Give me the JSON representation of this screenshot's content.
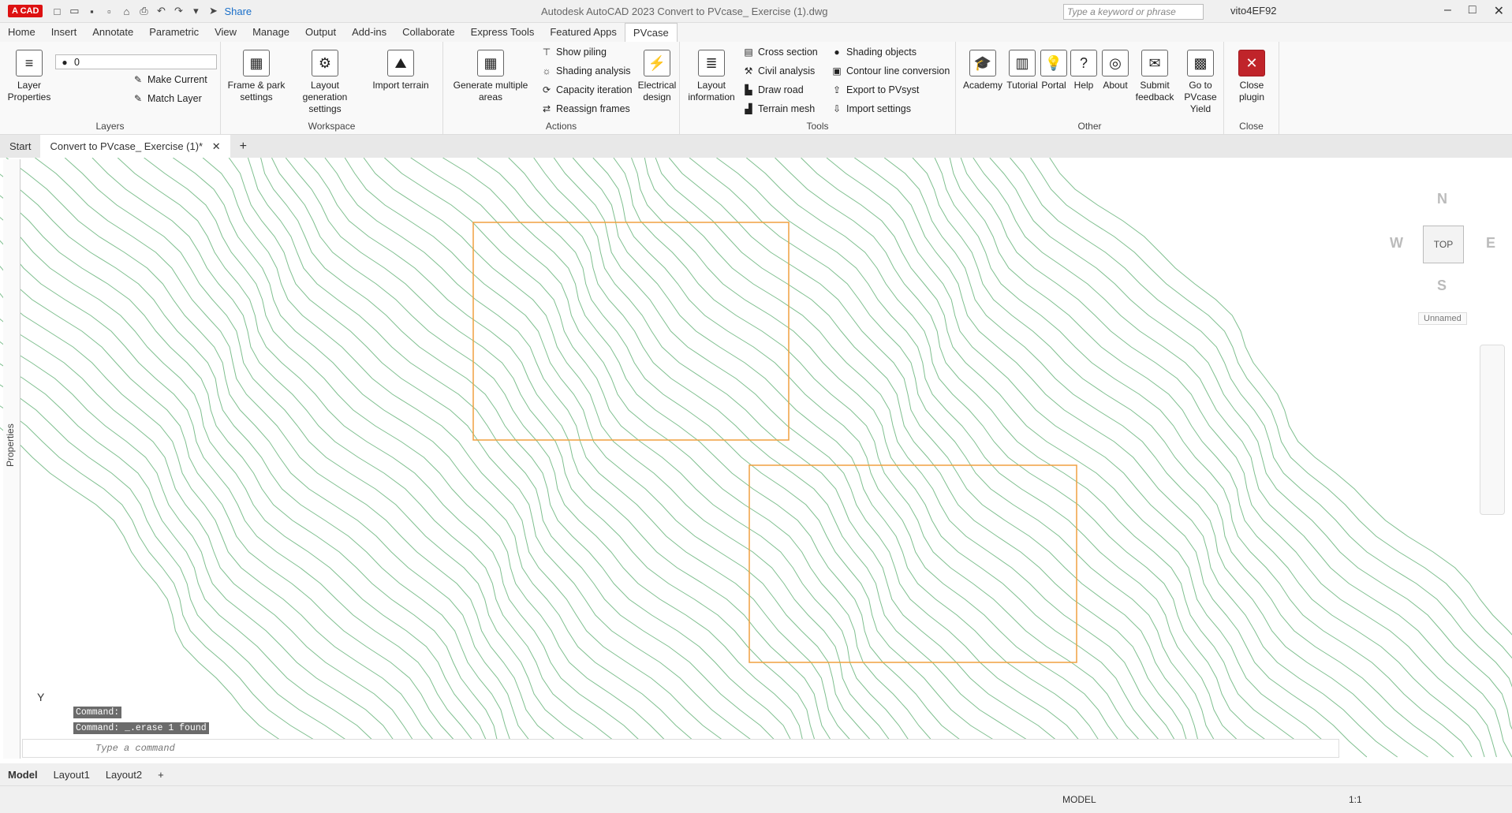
{
  "titlebar": {
    "logo": "A CAD",
    "share": "Share",
    "title": "Autodesk AutoCAD 2023    Convert to PVcase_ Exercise (1).dwg",
    "search_placeholder": "Type a keyword or phrase",
    "user": "vito4EF92"
  },
  "menu_tabs": [
    "Home",
    "Insert",
    "Annotate",
    "Parametric",
    "View",
    "Manage",
    "Output",
    "Add-ins",
    "Collaborate",
    "Express Tools",
    "Featured Apps",
    "PVcase"
  ],
  "ribbon": {
    "layers": {
      "label": "Layers",
      "layer_props": "Layer Properties",
      "current_layer": "0",
      "make_current": "Make Current",
      "match_layer": "Match Layer"
    },
    "workspace": {
      "label": "Workspace",
      "frame": "Frame & park settings",
      "layout_gen": "Layout generation settings",
      "import_terrain": "Import terrain"
    },
    "actions": {
      "label": "Actions",
      "generate": "Generate multiple areas",
      "show_piling": "Show piling",
      "shading_analysis": "Shading analysis",
      "capacity": "Capacity iteration",
      "reassign": "Reassign frames",
      "electrical": "Electrical design"
    },
    "tools": {
      "label": "Tools",
      "layout_info": "Layout information",
      "cross_section": "Cross section",
      "civil": "Civil analysis",
      "draw_road": "Draw road",
      "terrain_mesh": "Terrain mesh",
      "shading_objects": "Shading objects",
      "contour": "Contour line conversion",
      "export_pvsyst": "Export to PVsyst",
      "import_settings": "Import settings"
    },
    "other": {
      "label": "Other",
      "academy": "Academy",
      "tutorial": "Tutorial",
      "portal": "Portal",
      "help": "Help",
      "about": "About",
      "feedback": "Submit feedback",
      "pvcase_yield": "Go to PVcase Yield"
    },
    "close": {
      "label": "Close",
      "close_plugin": "Close plugin"
    }
  },
  "doc_tabs": {
    "start": "Start",
    "active": "Convert to PVcase_ Exercise (1)*"
  },
  "sidebar": {
    "properties": "Properties"
  },
  "viewcube": {
    "n": "N",
    "s": "S",
    "e": "E",
    "w": "W",
    "top": "TOP",
    "unnamed": "Unnamed"
  },
  "command": {
    "history": [
      "Command:",
      "Command: _.erase 1 found"
    ],
    "placeholder": "Type a command"
  },
  "ucs": {
    "y": "Y"
  },
  "layout_tabs": [
    "Model",
    "Layout1",
    "Layout2"
  ],
  "status": {
    "model": "MODEL",
    "scale": "1:1"
  },
  "colors": {
    "contour": "#7fbf8f",
    "boundary": "#f0a040"
  }
}
